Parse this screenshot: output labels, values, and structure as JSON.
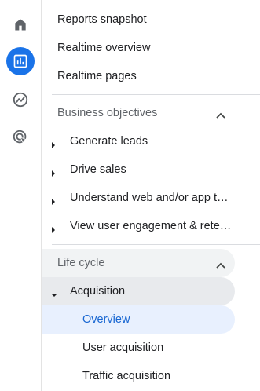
{
  "rail": {
    "items": [
      {
        "icon": "home-icon",
        "active": false
      },
      {
        "icon": "reports-icon",
        "active": true
      },
      {
        "icon": "explore-icon",
        "active": false
      },
      {
        "icon": "advertising-icon",
        "active": false
      }
    ],
    "accent": "#1a73e8"
  },
  "top_links": [
    "Reports snapshot",
    "Realtime overview",
    "Realtime pages"
  ],
  "business_objectives": {
    "title": "Business objectives",
    "items": [
      "Generate leads",
      "Drive sales",
      "Understand web and/or app traffic",
      "View user engagement & retention"
    ]
  },
  "life_cycle": {
    "title": "Life cycle",
    "acquisition": {
      "label": "Acquisition",
      "items": [
        "Overview",
        "User acquisition",
        "Traffic acquisition"
      ],
      "selected": "Overview"
    }
  },
  "colors": {
    "selected_bg": "#e8f0fe",
    "selected_text": "#1967d2",
    "divider": "#dadce0"
  }
}
